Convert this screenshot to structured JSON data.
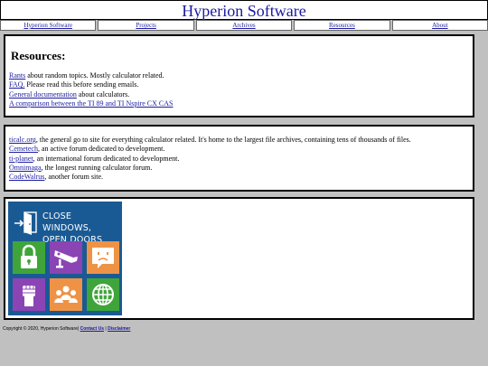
{
  "site_title": "Hyperion Software",
  "nav": [
    "Hyperion Software",
    "Projects",
    "Archives",
    "Resources",
    "About"
  ],
  "resources": {
    "heading": "Resources:",
    "items": [
      {
        "link": "Rants",
        "text": " about random topics. Mostly calculator related."
      },
      {
        "link": "FAQ.",
        "text": " Please read this before sending emails."
      },
      {
        "link": "General documentation",
        "text": " about calculators."
      },
      {
        "link": "A comparison between the TI 89 and TI Nspire CX CAS",
        "text": ""
      }
    ]
  },
  "sites": [
    {
      "link": "ticalc.org",
      "text": ", the general go to site for everything calculator related. It's home to the largest file archives, containing tens of thousands of files."
    },
    {
      "link": "Cemetech",
      "text": ", an active forum dedicated to development."
    },
    {
      "link": "ti-planet",
      "text": ", an international forum dedicated to development."
    },
    {
      "link": "Omnimaga",
      "text": ", the longest running calculator forum."
    },
    {
      "link": "CodeWalrus",
      "text": ", another forum site."
    }
  ],
  "poster": {
    "line1": "CLOSE WINDOWS,",
    "line2": "OPEN DOORS",
    "icons": [
      "padlock-icon",
      "surveillance-camera-icon",
      "sad-face-icon",
      "raised-fist-icon",
      "people-icon",
      "globe-icon"
    ]
  },
  "footer": {
    "copyright": "Copyright © 2020, Hyperion Software|",
    "contact": "Contact Us",
    "sep": " | ",
    "disclaimer": "Disclaimer"
  },
  "colors": {
    "link": "#1a1aa0",
    "page_bg": "#c0c0c0",
    "poster_bg": "#1a5a94"
  }
}
